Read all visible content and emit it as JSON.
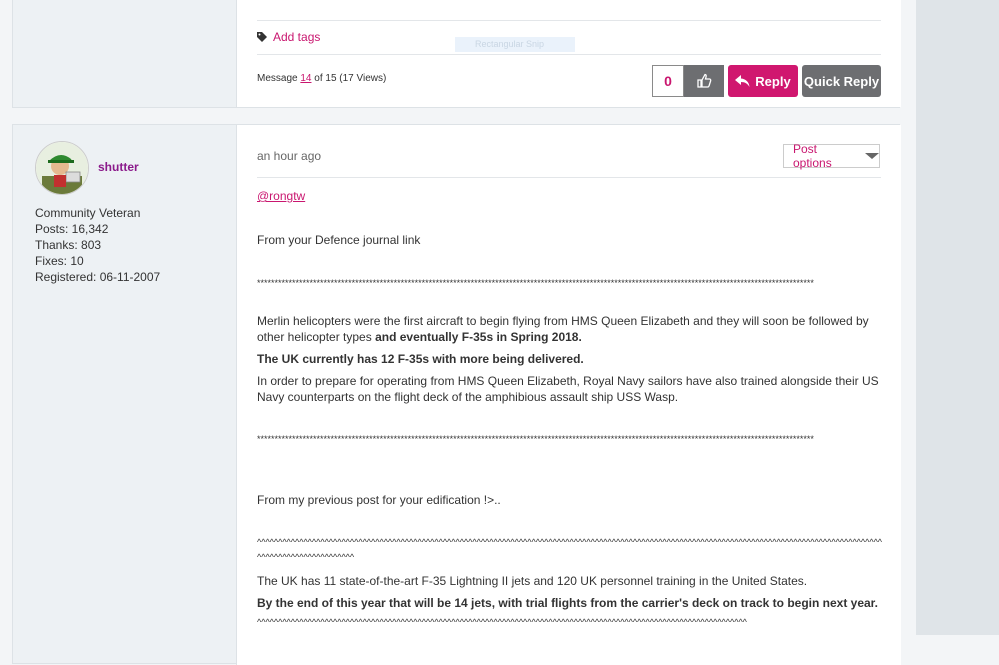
{
  "previous_post": {
    "add_tags_label": "Add tags",
    "ghost_label": "Rectangular Snip",
    "message_prefix": "Message ",
    "message_number": "14",
    "message_suffix": " of 15 (17 Views)",
    "kudos_count": "0",
    "reply_label": "Reply",
    "quick_reply_label": "Quick Reply"
  },
  "author": {
    "name": "shutter",
    "rank": "Community Veteran",
    "posts": "Posts: 16,342",
    "thanks": "Thanks: 803",
    "fixes": "Fixes: 10",
    "registered": "Registered: 06-11-2007"
  },
  "post": {
    "time": "an hour ago",
    "options_label": "Post options",
    "mention": "@rongtw",
    "intro": "From your Defence journal link",
    "stars_1": "***************************************************************************************************************************************************************",
    "para1_a": "Merlin helicopters were the first aircraft to begin flying from HMS Queen Elizabeth and they will soon be followed by other helicopter types ",
    "para1_b": "and eventually F-35s in Spring 2018.",
    "para2": "The UK currently has 12 F-35s with more being delivered.",
    "para3": "In order to prepare for operating from HMS Queen Elizabeth, Royal Navy sailors have also trained alongside their US Navy counterparts on the flight deck of the amphibious assault ship USS Wasp.",
    "stars_2": "***************************************************************************************************************************************************************",
    "previous_intro": "From my previous post for your edification !>..",
    "carets_1": "^^^^^^^^^^^^^^^^^^^^^^^^^^^^^^^^^^^^^^^^^^^^^^^^^^^^^^^^^^^^^^^^^^^^^^^^^^^^^^^^^^^^^^^^^^^^^^^^^^^^^^^^^^^^^^^^^^^^^^^^^^^^^^^^^^^^^^^^^^^^^^^^^^^^^^^^^^^^^^^^^^^^^^^^^^^",
    "para4": "The UK has 11 state-of-the-art F-35 Lightning II jets and 120 UK personnel training in the United States.",
    "para5": "By the end of this year that will be 14 jets, with trial flights from the carrier's deck on track to begin next year.",
    "carets_2": "^^^^^^^^^^^^^^^^^^^^^^^^^^^^^^^^^^^^^^^^^^^^^^^^^^^^^^^^^^^^^^^^^^^^^^^^^^^^^^^^^^^^^^^^^^^^^^^^^^^^^^^^^^^^^^^^^^^^"
  },
  "colors": {
    "accent": "#c9166f",
    "reply_button": "#d0176f",
    "grey_button": "#6d6e71",
    "author_name": "#8b1a8b"
  }
}
